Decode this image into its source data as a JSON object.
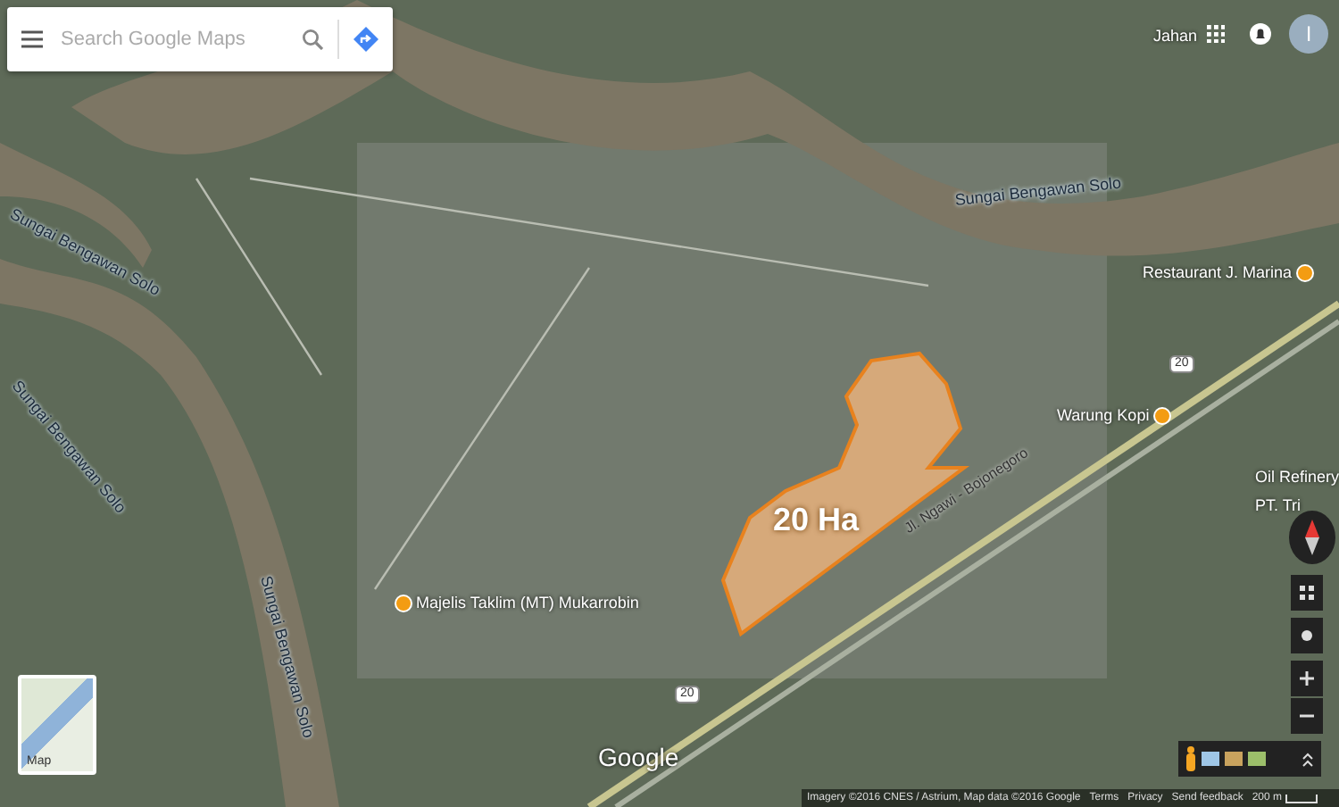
{
  "search": {
    "placeholder": "Search Google Maps"
  },
  "account": {
    "initial": "I"
  },
  "map_labels": [
    {
      "kind": "river",
      "text": "Sungai Bengawan Solo"
    },
    {
      "kind": "river",
      "text": "Sungai Bengawan Solo"
    },
    {
      "kind": "river",
      "text": "Sungai Bengawan Solo"
    },
    {
      "kind": "river",
      "text": "Sungai Bengawan Solo"
    },
    {
      "kind": "place",
      "text": "Jahan"
    },
    {
      "kind": "poi",
      "text": "Restaurant J. Marina"
    },
    {
      "kind": "poi",
      "text": "Warung Kopi"
    },
    {
      "kind": "road",
      "text": "Jl. Ngawi - Bojonegoro"
    },
    {
      "kind": "shield",
      "text": "20"
    },
    {
      "kind": "shield",
      "text": "20"
    },
    {
      "kind": "poi",
      "text": "Majelis Taklim (MT) Mukarrobin"
    },
    {
      "kind": "place",
      "text": "Oil Refinery"
    },
    {
      "kind": "place",
      "text": "PT. Tri"
    }
  ],
  "area": {
    "label": "20 Ha"
  },
  "logo": "Google",
  "layer_thumbnail": {
    "label": "Map"
  },
  "footer": {
    "attribution": "Imagery ©2016 CNES / Astrium, Map data ©2016 Google",
    "links": [
      "Terms",
      "Privacy",
      "Send feedback"
    ],
    "scale": "200 m"
  }
}
